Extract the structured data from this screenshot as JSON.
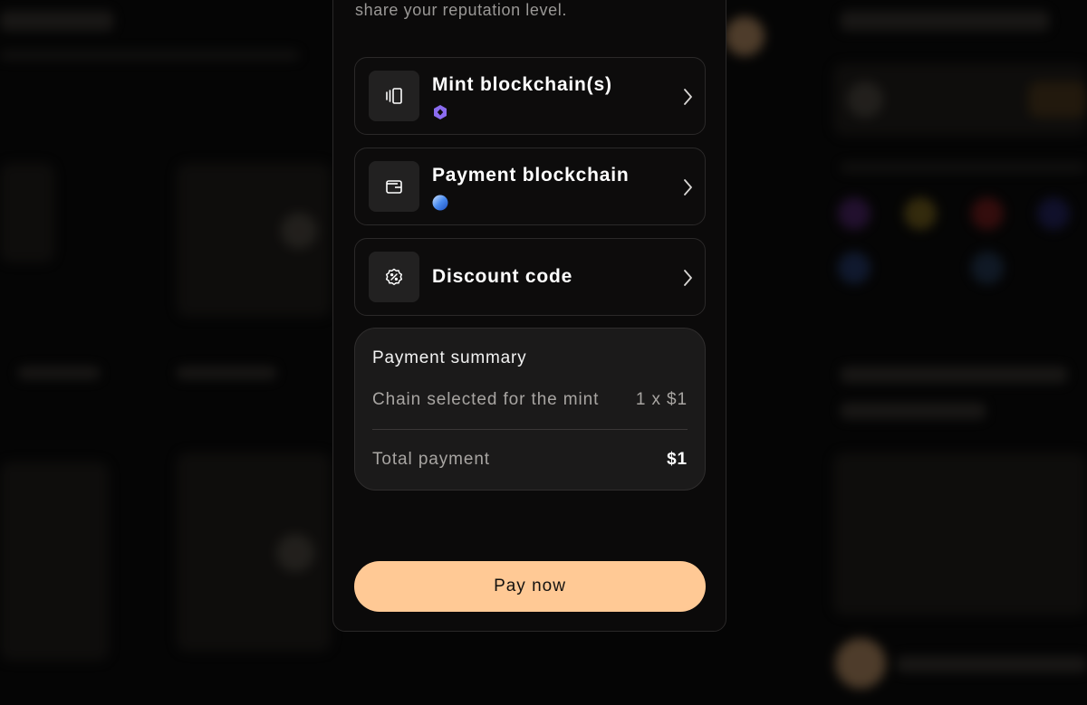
{
  "modal": {
    "subtitle": "share your reputation level."
  },
  "options": {
    "mint": {
      "label": "Mint blockchain(s)",
      "icon": "layers-icon",
      "chain_icon": "hexagon-chain-icon",
      "chain_color": "#8b6cf0"
    },
    "payment": {
      "label": "Payment blockchain",
      "icon": "wallet-icon",
      "chain_icon": "sphere-chain-icon",
      "chain_color": "#3b82f6"
    },
    "discount": {
      "label": "Discount code",
      "icon": "discount-badge-icon"
    }
  },
  "summary": {
    "title": "Payment summary",
    "line_label": "Chain selected for the mint",
    "line_value": "1 x $1",
    "total_label": "Total payment",
    "total_value": "$1"
  },
  "actions": {
    "pay_label": "Pay now"
  },
  "colors": {
    "accent": "#ffc995",
    "background": "#050505",
    "card": "#1b1a1a"
  }
}
